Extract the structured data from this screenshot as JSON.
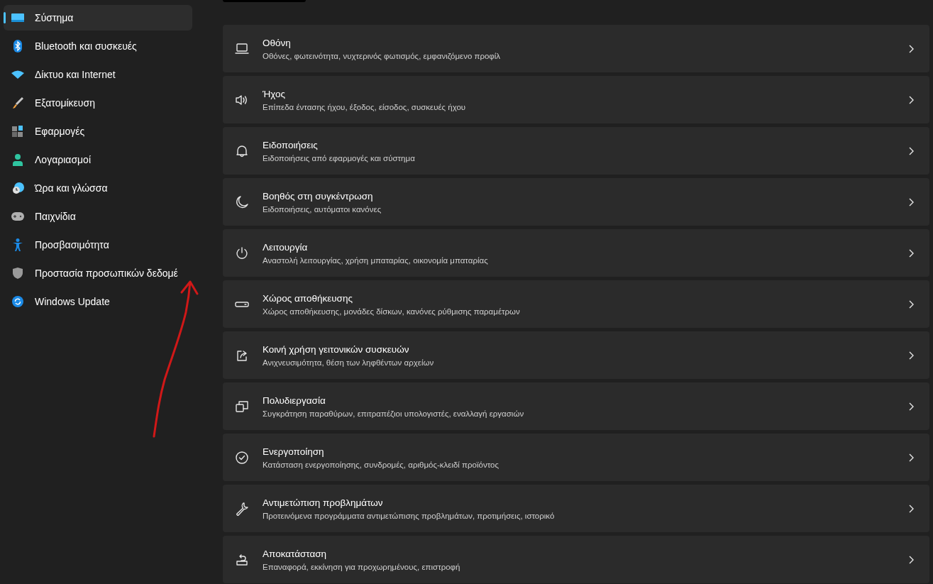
{
  "sidebar": {
    "items": [
      {
        "label": "Σύστημα",
        "selected": true
      },
      {
        "label": "Bluetooth και συσκευές",
        "selected": false
      },
      {
        "label": "Δίκτυο και Internet",
        "selected": false
      },
      {
        "label": "Εξατομίκευση",
        "selected": false
      },
      {
        "label": "Εφαρμογές",
        "selected": false
      },
      {
        "label": "Λογαριασμοί",
        "selected": false
      },
      {
        "label": "Ώρα και γλώσσα",
        "selected": false
      },
      {
        "label": "Παιχνίδια",
        "selected": false
      },
      {
        "label": "Προσβασιμότητα",
        "selected": false
      },
      {
        "label": "Προστασία προσωπικών δεδομέ",
        "selected": false
      },
      {
        "label": "Windows Update",
        "selected": false
      }
    ]
  },
  "settings": [
    {
      "title": "Οθόνη",
      "description": "Οθόνες, φωτεινότητα, νυχτερινός φωτισμός, εμφανιζόμενο προφίλ"
    },
    {
      "title": "Ήχος",
      "description": "Επίπεδα έντασης ήχου, έξοδος, είσοδος, συσκευές ήχου"
    },
    {
      "title": "Ειδοποιήσεις",
      "description": "Ειδοποιήσεις από εφαρμογές και σύστημα"
    },
    {
      "title": "Βοηθός στη συγκέντρωση",
      "description": "Ειδοποιήσεις, αυτόματοι κανόνες"
    },
    {
      "title": "Λειτουργία",
      "description": "Αναστολή λειτουργίας, χρήση μπαταρίας, οικονομία μπαταρίας"
    },
    {
      "title": "Χώρος αποθήκευσης",
      "description": "Χώρος αποθήκευσης, μονάδες δίσκων, κανόνες ρύθμισης παραμέτρων"
    },
    {
      "title": "Κοινή χρήση γειτονικών συσκευών",
      "description": "Ανιχνευσιμότητα, θέση των ληφθέντων αρχείων"
    },
    {
      "title": "Πολυδιεργασία",
      "description": "Συγκράτηση παραθύρων, επιτραπέζιοι υπολογιστές, εναλλαγή εργασιών"
    },
    {
      "title": "Ενεργοποίηση",
      "description": "Κατάσταση ενεργοποίησης, συνδρομές, αριθμός-κλειδί προϊόντος"
    },
    {
      "title": "Αντιμετώπιση προβλημάτων",
      "description": "Προτεινόμενα προγράμματα αντιμετώπισης προβλημάτων, προτιμήσεις, ιστορικό"
    },
    {
      "title": "Αποκατάσταση",
      "description": "Επαναφορά, εκκίνηση για προχωρημένους, επιστροφή"
    }
  ]
}
